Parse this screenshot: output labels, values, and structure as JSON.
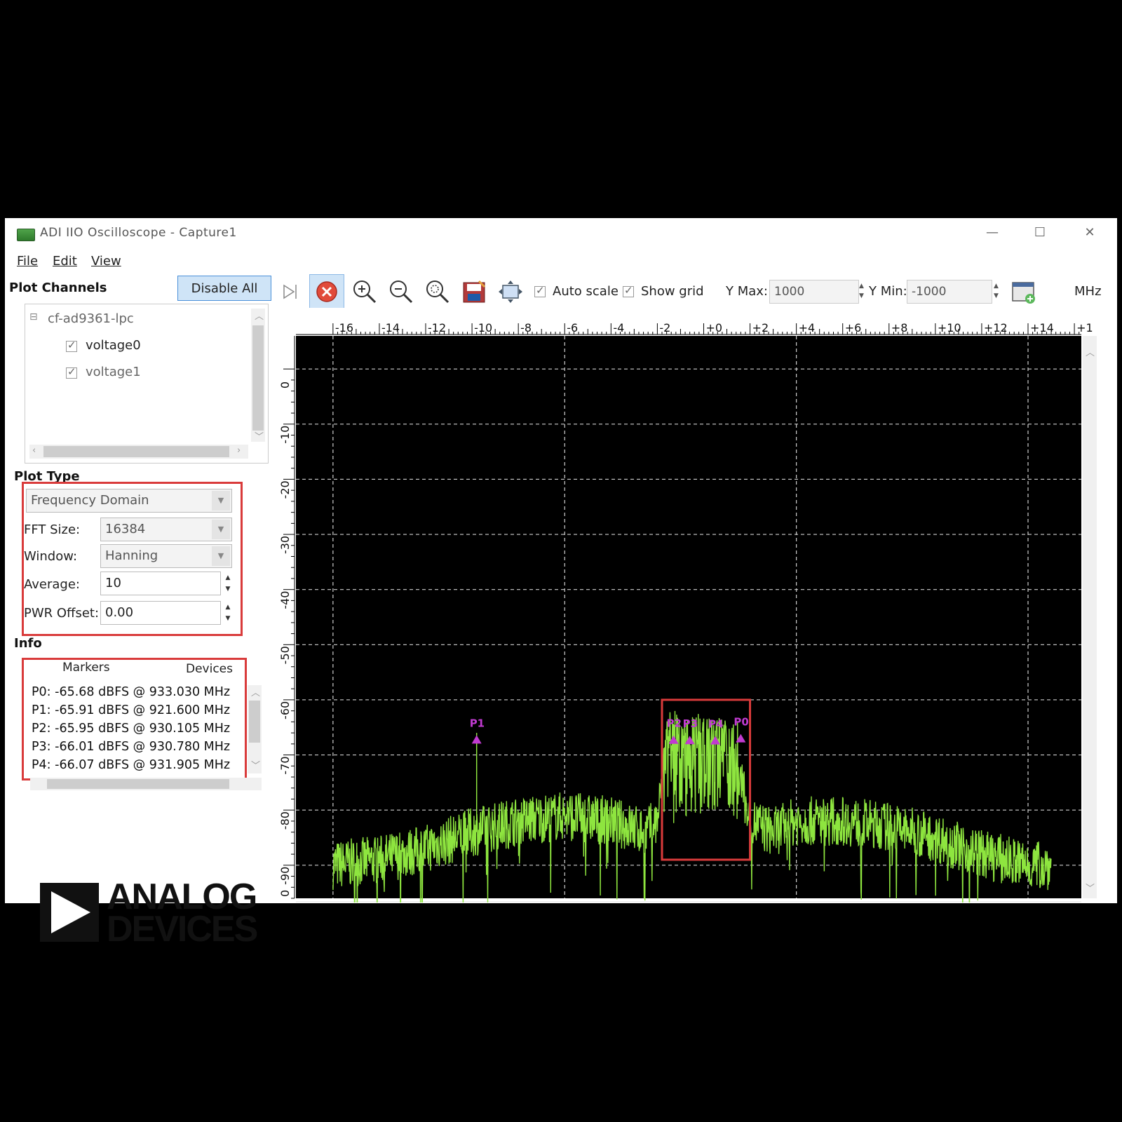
{
  "window": {
    "title": "ADI IIO Oscilloscope - Capture1",
    "minimize": "—",
    "maximize": "☐",
    "close": "✕"
  },
  "menu": [
    "File",
    "Edit",
    "View"
  ],
  "plot_channels": {
    "label": "Plot Channels",
    "disable_all": "Disable All",
    "device": "cf-ad9361-lpc",
    "collapse": "⊟",
    "channels": [
      "voltage0",
      "voltage1"
    ]
  },
  "plot_type": {
    "label": "Plot Type",
    "domain": "Frequency Domain",
    "fft_size_label": "FFT Size:",
    "fft_size": "16384",
    "window_label": "Window:",
    "window": "Hanning",
    "average_label": "Average:",
    "average": "10",
    "pwr_offset_label": "PWR Offset:",
    "pwr_offset": "0.00"
  },
  "info": {
    "label": "Info",
    "tabs": [
      "Markers",
      "Devices"
    ],
    "markers": [
      "P0: -65.68 dBFS @ 933.030 MHz",
      "P1: -65.91 dBFS @ 921.600 MHz",
      "P2: -65.95 dBFS @ 930.105 MHz",
      "P3: -66.01 dBFS @ 930.780 MHz",
      "P4: -66.07 dBFS @ 931.905 MHz"
    ]
  },
  "logo": {
    "line1": "ANALOG",
    "line2": "DEVICES"
  },
  "toolbar": {
    "auto_scale": "Auto scale",
    "show_grid": "Show grid",
    "ymax_label": "Y Max:",
    "ymax": "1000",
    "ymin_label": "Y Min:",
    "ymin": "-1000",
    "unit": "MHz"
  },
  "colors": {
    "trace": "#8ee53f",
    "marker": "#c13bd1",
    "highlight": "#d93b3b",
    "grid": "#cfcfcf"
  },
  "chart_data": {
    "type": "line",
    "title": "",
    "xlabel": "MHz",
    "ylabel": "",
    "xlim": [
      -17.6,
      16.3
    ],
    "ylim": [
      -96,
      6
    ],
    "x_ticks": [
      "-16",
      "-14",
      "-12",
      "-10",
      "-8",
      "-6",
      "-4",
      "-2",
      "+0",
      "+2",
      "+4",
      "+6",
      "+8",
      "+10",
      "+12",
      "+14",
      "+1"
    ],
    "y_ticks": [
      "0",
      "-10",
      "-20",
      "-30",
      "-40",
      "-50",
      "-60",
      "-70",
      "-80",
      "-90",
      "0"
    ],
    "grid": true,
    "series": [
      {
        "x": [
          -16,
          -14,
          -12,
          -10,
          -8,
          -6,
          -4,
          -2.5,
          -2,
          -1.8,
          -1.5,
          0,
          1.5,
          2,
          3,
          4,
          6,
          8,
          10,
          12,
          14,
          15
        ],
        "values": [
          -90,
          -89,
          -87,
          -84,
          -82,
          -81,
          -82,
          -84,
          -82,
          -75,
          -72,
          -72,
          -73,
          -82,
          -84,
          -82,
          -82,
          -83,
          -85,
          -88,
          -90,
          -90
        ]
      }
    ],
    "markers": [
      {
        "name": "P0",
        "x": 1.6,
        "y": -65.68
      },
      {
        "name": "P1",
        "x": -9.8,
        "y": -65.91
      },
      {
        "name": "P2",
        "x": -1.3,
        "y": -65.95
      },
      {
        "name": "P3",
        "x": -0.6,
        "y": -66.01
      },
      {
        "name": "P4",
        "x": 0.5,
        "y": -66.07
      }
    ],
    "annotation": "highlight box around band -1.8 to 2.0 MHz"
  }
}
